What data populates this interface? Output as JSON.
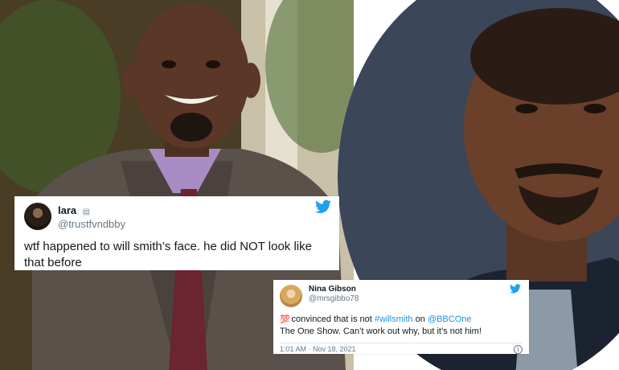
{
  "tweets": [
    {
      "name": "lara",
      "badge_icon": "clipboard-icon",
      "handle": "@trustfvndbby",
      "text": "wtf happened to will smith’s face. he did NOT look like that before",
      "brand_icon": "twitter-bird-icon"
    },
    {
      "name": "Nina Gibson",
      "handle": "@mrsgibbo78",
      "emoji": "💯",
      "text_a": " convinced that is not ",
      "hashtag": "#willsmith",
      "text_b": " on ",
      "mention": "@BBCOne",
      "text_c": "The One Show. Can’t work out why, but it’s not him!",
      "timestamp": "1:01 AM · Nov 18, 2021",
      "brand_icon": "twitter-bird-icon",
      "info_icon": "info-icon"
    }
  ],
  "colors": {
    "twitter_blue": "#1da1f2",
    "link_blue": "#1b95e0",
    "text_dark": "#14171a",
    "text_muted": "#657786"
  }
}
